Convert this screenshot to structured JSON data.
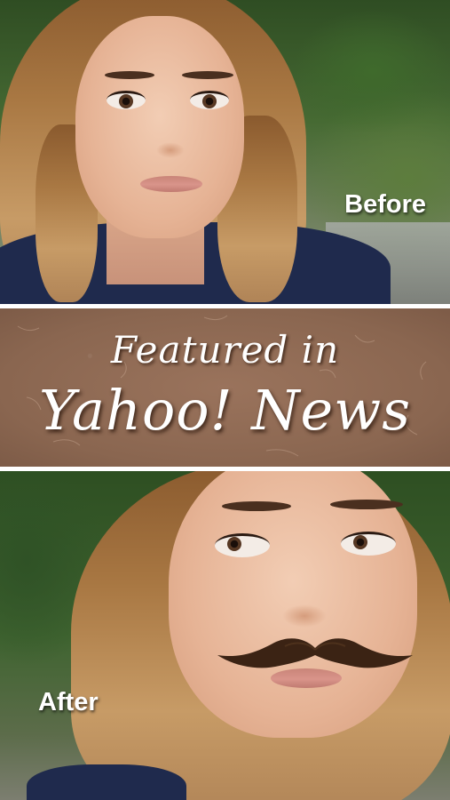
{
  "before_panel": {
    "label": "Before"
  },
  "banner": {
    "line1": "Featured in",
    "line2": "Yahoo! News",
    "background_color": "#8a6650",
    "text_color": "#ffffff"
  },
  "after_panel": {
    "label": "After",
    "overlay": "mustache-icon",
    "overlay_color": "#3b2314"
  }
}
